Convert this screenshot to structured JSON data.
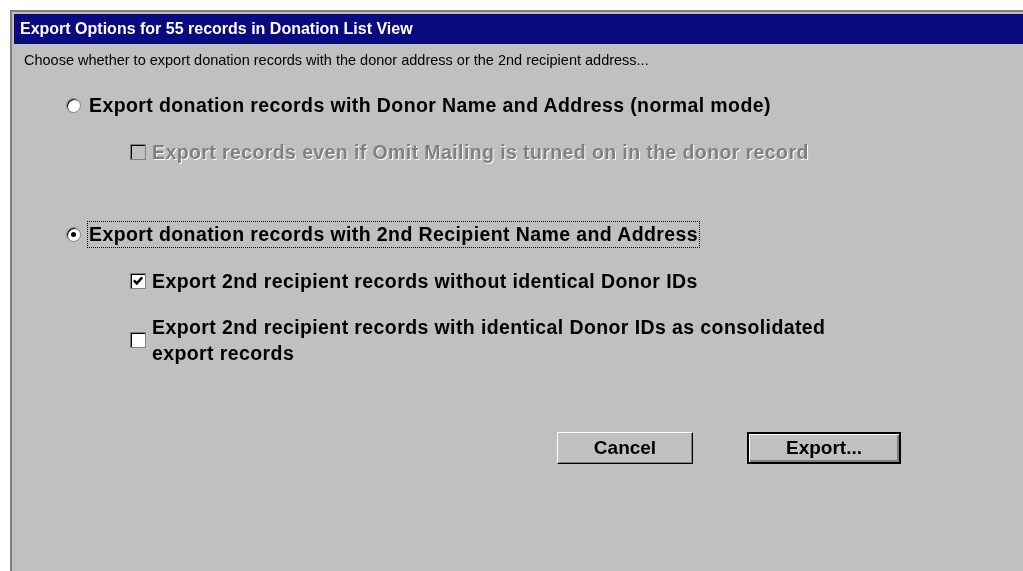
{
  "window": {
    "title": "Export Options for 55 records in Donation List View"
  },
  "instruction": "Choose whether to export donation records with the donor address or the 2nd recipient address...",
  "options": [
    {
      "label": "Export donation records with Donor Name and Address (normal mode)",
      "selected": false,
      "focused": false,
      "suboptions": [
        {
          "label": "Export records even if Omit Mailing is turned on in the donor record",
          "checked": false,
          "disabled": true
        }
      ]
    },
    {
      "label": "Export donation records with 2nd Recipient Name and Address",
      "selected": true,
      "focused": true,
      "suboptions": [
        {
          "label": "Export 2nd recipient records without identical Donor IDs",
          "checked": true,
          "disabled": false
        },
        {
          "label": "Export 2nd recipient records with identical Donor IDs as consolidated export records",
          "checked": false,
          "disabled": false
        }
      ]
    }
  ],
  "buttons": [
    {
      "label": "Cancel",
      "default": false
    },
    {
      "label": "Export...",
      "default": true
    }
  ]
}
